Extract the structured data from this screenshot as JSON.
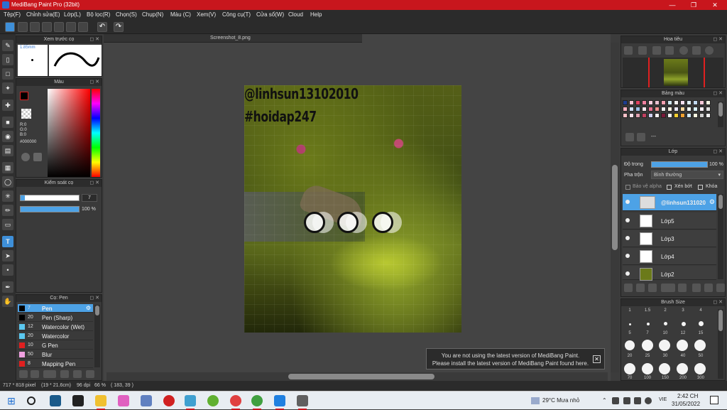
{
  "window": {
    "title": "MediBang Paint Pro (32bit)"
  },
  "menu": [
    "Tệp(F)",
    "Chỉnh sửa(E)",
    "Lớp(L)",
    "Bộ lọc(R)",
    "Chọn(S)",
    "Chụp(N)",
    "Màu (C)",
    "Xem(V)",
    "Công cụ(T)",
    "Cửa sổ(W)",
    "Cloud",
    "Help"
  ],
  "canvas": {
    "tab_title": "Screenshot_8.png",
    "text_line1": "@linhsun13102010",
    "text_line2": "#hoidap247"
  },
  "panels": {
    "brush_preview": {
      "title": "Xem trước cọ",
      "size": "1.85mm"
    },
    "color": {
      "title": "Màu",
      "r": "R:0",
      "g": "G:0",
      "b": "B:0",
      "hex": "#000000"
    },
    "brush_control": {
      "title": "Kiểm soát cọ",
      "size_value": "7",
      "opacity_value": "100 %"
    },
    "brush_list": {
      "title": "Cọ: Pen",
      "items": [
        {
          "size": "7",
          "name": "Pen",
          "color": "#000000"
        },
        {
          "size": "20",
          "name": "Pen (Sharp)",
          "color": "#000000"
        },
        {
          "size": "12",
          "name": "Watercolor (Wet)",
          "color": "#5bc8f0"
        },
        {
          "size": "20",
          "name": "Watercolor",
          "color": "#5bc8f0"
        },
        {
          "size": "10",
          "name": "G Pen",
          "color": "#e02020"
        },
        {
          "size": "50",
          "name": "Blur",
          "color": "#f0a0e0"
        },
        {
          "size": "8",
          "name": "Mapping Pen",
          "color": "#e02020"
        }
      ]
    },
    "navigator": {
      "title": "Hoa tiêu"
    },
    "palette": {
      "title": "Bảng màu",
      "footer": "---"
    },
    "layers": {
      "title": "Lớp",
      "opacity_label": "Độ trong",
      "opacity_value": "100 %",
      "blend_label": "Pha trộn",
      "blend_value": "Bình thường",
      "protect_alpha": "Bảo vệ alpha",
      "clip": "Xén bớt",
      "lock": "Khóa",
      "items": [
        {
          "name": "@linhsun131020"
        },
        {
          "name": "Lớp5"
        },
        {
          "name": "Lớp3"
        },
        {
          "name": "Lớp4"
        },
        {
          "name": "Lớp2"
        }
      ]
    },
    "brush_size": {
      "title": "Brush Size",
      "rows": [
        [
          "1",
          "1.5",
          "2",
          "3",
          "4"
        ],
        [
          "5",
          "7",
          "10",
          "12",
          "15"
        ],
        [
          "20",
          "25",
          "30",
          "40",
          "50"
        ],
        [
          "70",
          "100",
          "150",
          "200",
          "300"
        ]
      ]
    }
  },
  "notice": {
    "line1": "You are not using the latest version of MediBang Paint.",
    "line2": "Please install the latest version of MediBang Paint found here."
  },
  "status": {
    "dimensions": "717 * 818 pixel",
    "physical": "(19 * 21.6cm)",
    "dpi": "96 dpi",
    "zoom": "66 %",
    "coords": "( 183, 39 )"
  },
  "taskbar": {
    "weather": "29°C  Mưa nhỏ",
    "lang": "VIE",
    "time": "2:42 CH",
    "date": "31/05/2022"
  },
  "colors": {
    "title_bar": "#c8161d",
    "accent": "#4da2e6",
    "panel_bg": "#3a3a3a"
  }
}
